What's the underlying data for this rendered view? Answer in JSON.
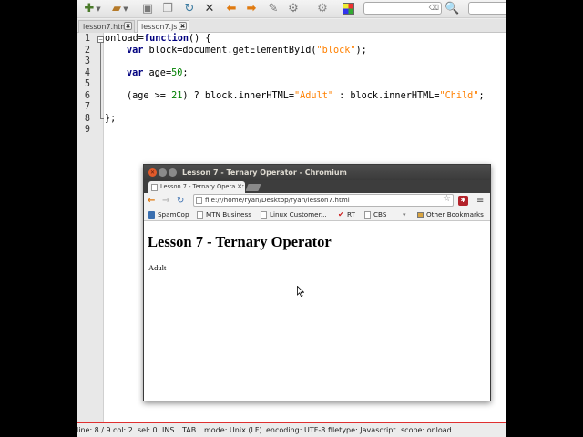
{
  "editor": {
    "tabs": [
      {
        "label": "lesson7.html",
        "close": "✖"
      },
      {
        "label": "lesson7.js",
        "close": "✖"
      }
    ],
    "search": {
      "clear": "⌫"
    },
    "line_numbers": [
      "1",
      "2",
      "3",
      "4",
      "5",
      "6",
      "7",
      "8",
      "9"
    ],
    "code": {
      "l1_a": "onload=",
      "l1_b": "function",
      "l1_c": "() {",
      "l2_kw": "var",
      "l2_a": " block=document.getElementById(",
      "l2_str": "\"block\"",
      "l2_b": ");",
      "l4_kw": "var",
      "l4_a": " age=",
      "l4_num": "50",
      "l4_b": ";",
      "l6_a": "(age >= ",
      "l6_num": "21",
      "l6_b": ") ? block.innerHTML=",
      "l6_str1": "\"Adult\"",
      "l6_c": " : block.innerHTML=",
      "l6_str2": "\"Child\"",
      "l6_d": ";",
      "l8": "};"
    },
    "status": {
      "line": "line: 8 / 9",
      "col": "col: 2",
      "sel": "sel: 0",
      "ins": "INS",
      "tab": "TAB",
      "mode": "mode: Unix (LF)",
      "encoding": "encoding: UTF-8",
      "filetype": "filetype: Javascript",
      "scope": "scope: onload"
    }
  },
  "browser": {
    "window_title": "Lesson 7 - Ternary Operator - Chromium",
    "tab_title": "Lesson 7 - Ternary Operator",
    "url": "file:///home/ryan/Desktop/ryan/lesson7.html",
    "extension_label": "✱",
    "bookmarks": [
      "SpamCop",
      "MTN Business",
      "Linux Customer...",
      "RT",
      "CBS"
    ],
    "other_bookmarks": "Other Bookmarks",
    "page": {
      "heading": "Lesson 7 - Ternary Operator",
      "result": "Adult"
    }
  }
}
